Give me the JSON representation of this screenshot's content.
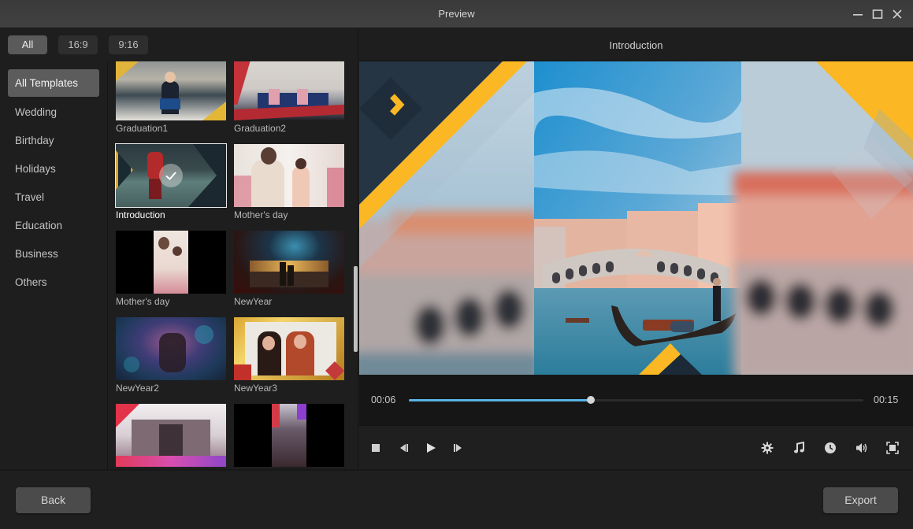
{
  "window": {
    "title": "Preview",
    "controls": [
      "minimize",
      "maximize",
      "close"
    ]
  },
  "filters": {
    "active": "All",
    "items": [
      {
        "label": "All"
      },
      {
        "label": "16:9"
      },
      {
        "label": "9:16"
      }
    ]
  },
  "sidebar": {
    "active": "All Templates",
    "items": [
      {
        "label": "All Templates"
      },
      {
        "label": "Wedding"
      },
      {
        "label": "Birthday"
      },
      {
        "label": "Holidays"
      },
      {
        "label": "Travel"
      },
      {
        "label": "Education"
      },
      {
        "label": "Business"
      },
      {
        "label": "Others"
      }
    ]
  },
  "templates": {
    "selected": "Introduction",
    "items": [
      {
        "label": "Graduation1"
      },
      {
        "label": "Graduation2"
      },
      {
        "label": "Introduction"
      },
      {
        "label": "Mother's day"
      },
      {
        "label": "Mother's day"
      },
      {
        "label": "NewYear"
      },
      {
        "label": "NewYear2"
      },
      {
        "label": "NewYear3"
      },
      {
        "label": ""
      },
      {
        "label": ""
      }
    ]
  },
  "preview": {
    "title": "Introduction",
    "accent_color": "#fbb824",
    "progress_color": "#5ab4e6",
    "current_time": "00:06",
    "total_time": "00:15",
    "progress_fraction": 0.4
  },
  "player_controls": {
    "left": [
      "stop-icon",
      "previous-frame-icon",
      "play-icon",
      "next-frame-icon"
    ],
    "right": [
      "settings-icon",
      "music-icon",
      "clock-icon",
      "volume-icon",
      "fullscreen-icon"
    ]
  },
  "footer": {
    "back_label": "Back",
    "export_label": "Export"
  }
}
